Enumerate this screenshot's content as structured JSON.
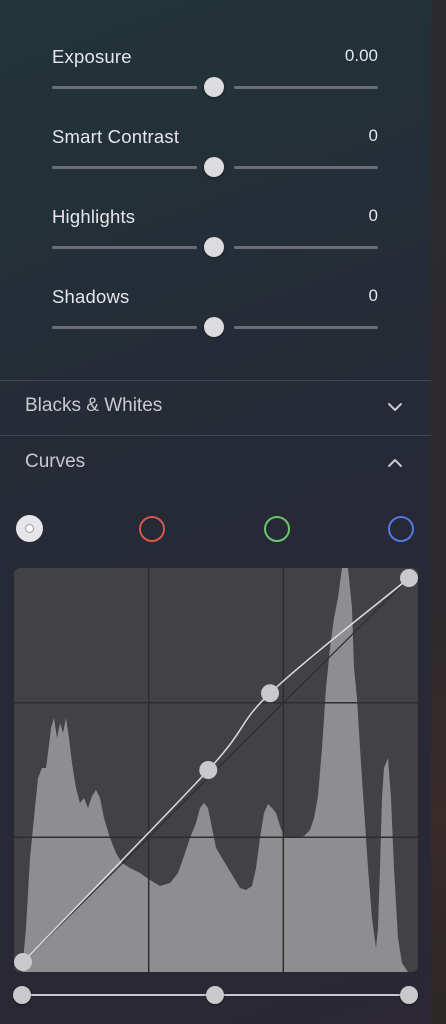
{
  "adjustments": [
    {
      "label": "Exposure",
      "value": "0.00"
    },
    {
      "label": "Smart Contrast",
      "value": "0"
    },
    {
      "label": "Highlights",
      "value": "0"
    },
    {
      "label": "Shadows",
      "value": "0"
    }
  ],
  "sections": {
    "blacks_whites": {
      "title": "Blacks & Whites",
      "state": "collapsed",
      "icon": "chevron-down-icon"
    },
    "curves": {
      "title": "Curves",
      "state": "expanded",
      "icon": "chevron-up-icon"
    }
  },
  "curve_channels": [
    {
      "name": "luminance",
      "color": "#e6e6ea",
      "selected": true
    },
    {
      "name": "red",
      "color": "#d4584a",
      "selected": false
    },
    {
      "name": "green",
      "color": "#6cc46d",
      "selected": false
    },
    {
      "name": "blue",
      "color": "#5578e0",
      "selected": false
    }
  ],
  "curve": {
    "control_points": [
      [
        0,
        0
      ],
      [
        0.48,
        0.5
      ],
      [
        0.64,
        0.7
      ],
      [
        1,
        1
      ]
    ],
    "input_range": {
      "black": 0,
      "mid": 0.5,
      "white": 1
    }
  },
  "colors": {
    "histogram": "#8e8e90",
    "curve_bg": "#424246",
    "grid": "#2e2e31",
    "curve_line": "#dcdcde"
  }
}
